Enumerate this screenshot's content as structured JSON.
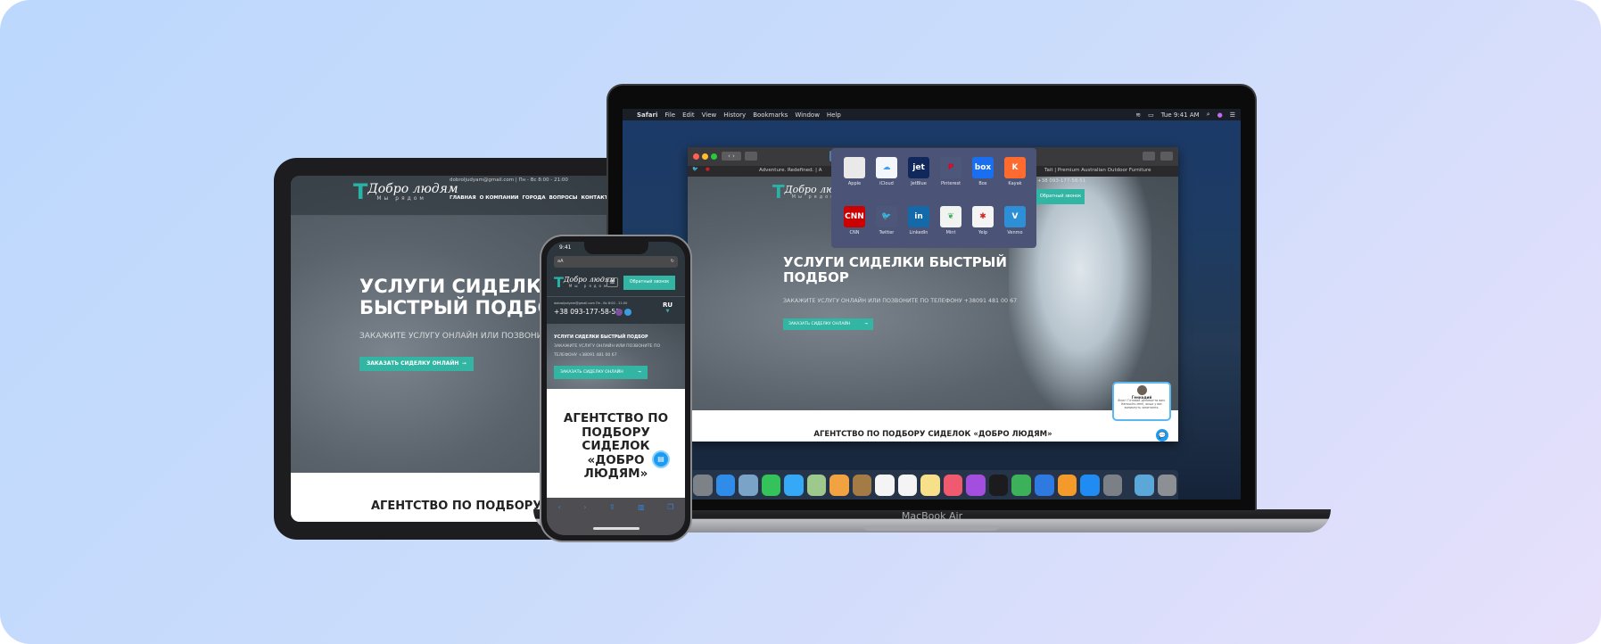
{
  "site": {
    "logo_title": "Добро людям",
    "logo_sub": "Мы рядом",
    "email_hours": "dobroljudyam@gmail.com  |  Пн - Вс 8:00 - 21:00",
    "nav": [
      "ГЛАВНАЯ",
      "О КОМПАНИИ",
      "ГОРОДА",
      "ВОПРОСЫ",
      "КОНТАКТЫ"
    ],
    "hero_title": "УСЛУГИ СИДЕЛКИ БЫСТРЫЙ ПОДБОР",
    "hero_sub": "ЗАКАЖИТЕ УСЛУГУ ОНЛАЙН ИЛИ ПОЗВОНИТЕ ПО ТЕЛЕФОНУ +38091 481 00 67",
    "order_button": "ЗАКАЗАТЬ СИДЕЛКУ ОНЛАЙН",
    "callback_button": "Обратный звонок",
    "phone": "+38 093-177-58-51",
    "language": "RU",
    "agency_title": "АГЕНТСТВО ПО ПОДБОРУ СИДЕЛОК «ДОБРО ЛЮДЯМ»",
    "agency_title_short": "АГЕНТСТВО ПО ПОДБОРУ",
    "mobile_email_hours": "dobroljudyam@gmail.com  Пн - Вс 8:00 - 21:00",
    "mobile_hero_title": "УСЛУГИ СИДЕЛКИ БЫСТРЫЙ ПОДБОР",
    "mobile_hero_sub": "ЗАКАЖИТЕ УСЛУГУ ОНЛАЙН ИЛИ ПОЗВОНИТЕ ПО ТЕЛЕФОНУ +38091 481 00 67"
  },
  "mac": {
    "menu": [
      "Safari",
      "File",
      "Edit",
      "View",
      "History",
      "Bookmarks",
      "Window",
      "Help"
    ],
    "clock": "Tue 9:41 AM",
    "tabs": [
      "Adventure. Redefined. | A",
      "Tait | Premium Australian Outdoor Furniture"
    ],
    "favorites": [
      {
        "label": "Apple",
        "glyph": "",
        "color": "#e9e9ea"
      },
      {
        "label": "iCloud",
        "glyph": "☁",
        "color": "#f3f6fb"
      },
      {
        "label": "JetBlue",
        "glyph": "jet",
        "color": "#10285c"
      },
      {
        "label": "Pinterest",
        "glyph": "P",
        "color": "#4d5779"
      },
      {
        "label": "Box",
        "glyph": "box",
        "color": "#1a6ff0"
      },
      {
        "label": "Kayak",
        "glyph": "K",
        "color": "#ff6a2e"
      },
      {
        "label": "CNN",
        "glyph": "CNN",
        "color": "#cc0000"
      },
      {
        "label": "Twitter",
        "glyph": "🐦",
        "color": "#4d5779"
      },
      {
        "label": "LinkedIn",
        "glyph": "in",
        "color": "#1469a8"
      },
      {
        "label": "Mint",
        "glyph": "❦",
        "color": "#f1f3f1"
      },
      {
        "label": "Yelp",
        "glyph": "✱",
        "color": "#f4f4f4"
      },
      {
        "label": "Venmo",
        "glyph": "V",
        "color": "#2d8fd5"
      }
    ],
    "dock_label": "MacBook Air",
    "dock": [
      {
        "name": "launchpad",
        "color": "#7d8288"
      },
      {
        "name": "safari",
        "color": "#2f8ce8"
      },
      {
        "name": "preview",
        "color": "#7aa3c8"
      },
      {
        "name": "facetime",
        "color": "#33c35a"
      },
      {
        "name": "messages",
        "color": "#35a9f5"
      },
      {
        "name": "maps",
        "color": "#9ec98d"
      },
      {
        "name": "photos",
        "color": "#f1a342"
      },
      {
        "name": "contacts",
        "color": "#a47a45"
      },
      {
        "name": "calendar",
        "color": "#f4f4f4"
      },
      {
        "name": "reminders",
        "color": "#f4f4f4"
      },
      {
        "name": "notes",
        "color": "#f7e08a"
      },
      {
        "name": "music",
        "color": "#f05a6e"
      },
      {
        "name": "podcasts",
        "color": "#a44ee0"
      },
      {
        "name": "tv",
        "color": "#1c1c1e"
      },
      {
        "name": "numbers",
        "color": "#3cb15a"
      },
      {
        "name": "keynote",
        "color": "#2e7ae0"
      },
      {
        "name": "pages",
        "color": "#f39a2b"
      },
      {
        "name": "app-store",
        "color": "#1f8bf3"
      },
      {
        "name": "system-preferences",
        "color": "#7b7f86"
      },
      {
        "name": "downloads",
        "color": "#5aa7d8"
      },
      {
        "name": "trash",
        "color": "#8c9095"
      }
    ]
  },
  "chat": {
    "name": "Геннадий",
    "message": "Флаг! Готовий допомогти вам. Напишіть мені, якщо у вас виникнуть запитання."
  },
  "phone_ui": {
    "time": "9:41",
    "url": "aA"
  },
  "colors": {
    "accent": "#33b5a4",
    "header": "#2e363d"
  }
}
